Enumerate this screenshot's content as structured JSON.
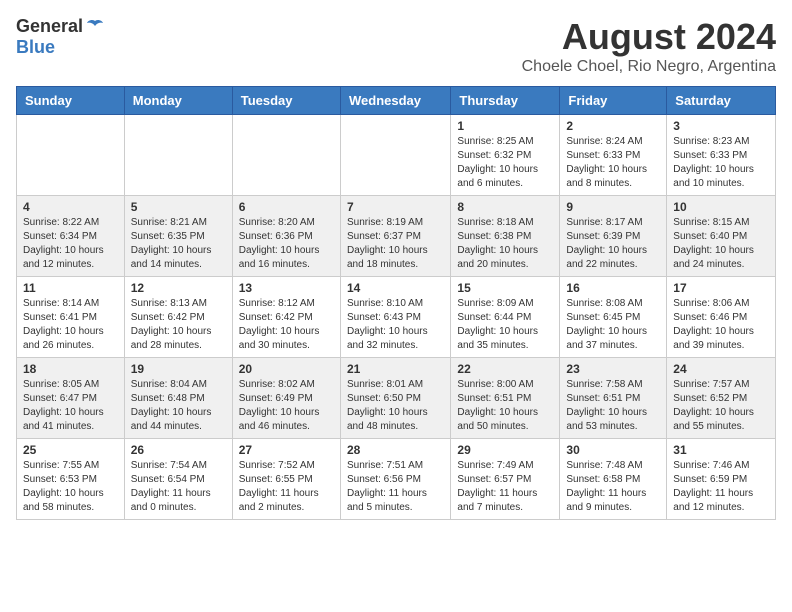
{
  "header": {
    "logo_general": "General",
    "logo_blue": "Blue",
    "month_title": "August 2024",
    "subtitle": "Choele Choel, Rio Negro, Argentina"
  },
  "days_of_week": [
    "Sunday",
    "Monday",
    "Tuesday",
    "Wednesday",
    "Thursday",
    "Friday",
    "Saturday"
  ],
  "weeks": [
    [
      {
        "day": "",
        "info": ""
      },
      {
        "day": "",
        "info": ""
      },
      {
        "day": "",
        "info": ""
      },
      {
        "day": "",
        "info": ""
      },
      {
        "day": "1",
        "info": "Sunrise: 8:25 AM\nSunset: 6:32 PM\nDaylight: 10 hours\nand 6 minutes."
      },
      {
        "day": "2",
        "info": "Sunrise: 8:24 AM\nSunset: 6:33 PM\nDaylight: 10 hours\nand 8 minutes."
      },
      {
        "day": "3",
        "info": "Sunrise: 8:23 AM\nSunset: 6:33 PM\nDaylight: 10 hours\nand 10 minutes."
      }
    ],
    [
      {
        "day": "4",
        "info": "Sunrise: 8:22 AM\nSunset: 6:34 PM\nDaylight: 10 hours\nand 12 minutes."
      },
      {
        "day": "5",
        "info": "Sunrise: 8:21 AM\nSunset: 6:35 PM\nDaylight: 10 hours\nand 14 minutes."
      },
      {
        "day": "6",
        "info": "Sunrise: 8:20 AM\nSunset: 6:36 PM\nDaylight: 10 hours\nand 16 minutes."
      },
      {
        "day": "7",
        "info": "Sunrise: 8:19 AM\nSunset: 6:37 PM\nDaylight: 10 hours\nand 18 minutes."
      },
      {
        "day": "8",
        "info": "Sunrise: 8:18 AM\nSunset: 6:38 PM\nDaylight: 10 hours\nand 20 minutes."
      },
      {
        "day": "9",
        "info": "Sunrise: 8:17 AM\nSunset: 6:39 PM\nDaylight: 10 hours\nand 22 minutes."
      },
      {
        "day": "10",
        "info": "Sunrise: 8:15 AM\nSunset: 6:40 PM\nDaylight: 10 hours\nand 24 minutes."
      }
    ],
    [
      {
        "day": "11",
        "info": "Sunrise: 8:14 AM\nSunset: 6:41 PM\nDaylight: 10 hours\nand 26 minutes."
      },
      {
        "day": "12",
        "info": "Sunrise: 8:13 AM\nSunset: 6:42 PM\nDaylight: 10 hours\nand 28 minutes."
      },
      {
        "day": "13",
        "info": "Sunrise: 8:12 AM\nSunset: 6:42 PM\nDaylight: 10 hours\nand 30 minutes."
      },
      {
        "day": "14",
        "info": "Sunrise: 8:10 AM\nSunset: 6:43 PM\nDaylight: 10 hours\nand 32 minutes."
      },
      {
        "day": "15",
        "info": "Sunrise: 8:09 AM\nSunset: 6:44 PM\nDaylight: 10 hours\nand 35 minutes."
      },
      {
        "day": "16",
        "info": "Sunrise: 8:08 AM\nSunset: 6:45 PM\nDaylight: 10 hours\nand 37 minutes."
      },
      {
        "day": "17",
        "info": "Sunrise: 8:06 AM\nSunset: 6:46 PM\nDaylight: 10 hours\nand 39 minutes."
      }
    ],
    [
      {
        "day": "18",
        "info": "Sunrise: 8:05 AM\nSunset: 6:47 PM\nDaylight: 10 hours\nand 41 minutes."
      },
      {
        "day": "19",
        "info": "Sunrise: 8:04 AM\nSunset: 6:48 PM\nDaylight: 10 hours\nand 44 minutes."
      },
      {
        "day": "20",
        "info": "Sunrise: 8:02 AM\nSunset: 6:49 PM\nDaylight: 10 hours\nand 46 minutes."
      },
      {
        "day": "21",
        "info": "Sunrise: 8:01 AM\nSunset: 6:50 PM\nDaylight: 10 hours\nand 48 minutes."
      },
      {
        "day": "22",
        "info": "Sunrise: 8:00 AM\nSunset: 6:51 PM\nDaylight: 10 hours\nand 50 minutes."
      },
      {
        "day": "23",
        "info": "Sunrise: 7:58 AM\nSunset: 6:51 PM\nDaylight: 10 hours\nand 53 minutes."
      },
      {
        "day": "24",
        "info": "Sunrise: 7:57 AM\nSunset: 6:52 PM\nDaylight: 10 hours\nand 55 minutes."
      }
    ],
    [
      {
        "day": "25",
        "info": "Sunrise: 7:55 AM\nSunset: 6:53 PM\nDaylight: 10 hours\nand 58 minutes."
      },
      {
        "day": "26",
        "info": "Sunrise: 7:54 AM\nSunset: 6:54 PM\nDaylight: 11 hours\nand 0 minutes."
      },
      {
        "day": "27",
        "info": "Sunrise: 7:52 AM\nSunset: 6:55 PM\nDaylight: 11 hours\nand 2 minutes."
      },
      {
        "day": "28",
        "info": "Sunrise: 7:51 AM\nSunset: 6:56 PM\nDaylight: 11 hours\nand 5 minutes."
      },
      {
        "day": "29",
        "info": "Sunrise: 7:49 AM\nSunset: 6:57 PM\nDaylight: 11 hours\nand 7 minutes."
      },
      {
        "day": "30",
        "info": "Sunrise: 7:48 AM\nSunset: 6:58 PM\nDaylight: 11 hours\nand 9 minutes."
      },
      {
        "day": "31",
        "info": "Sunrise: 7:46 AM\nSunset: 6:59 PM\nDaylight: 11 hours\nand 12 minutes."
      }
    ]
  ]
}
